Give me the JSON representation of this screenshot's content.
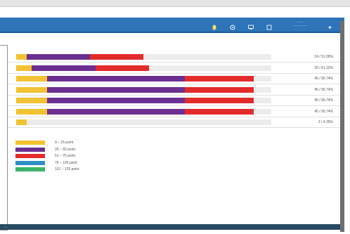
{
  "titlebar": {
    "user_line1": "— —",
    "user_line2": "— — — —"
  },
  "bottom_bar": {
    "label": "—"
  },
  "bars": [
    {
      "yellow": 4,
      "purple": 25,
      "red": 21,
      "value_label": "24 / 51.09%"
    },
    {
      "yellow": 6,
      "purple": 25,
      "red": 21,
      "value_label": "26 / 61.19%"
    },
    {
      "yellow": 12,
      "purple": 54,
      "red": 27,
      "value_label": "45 / 95.74%"
    },
    {
      "yellow": 12,
      "purple": 54,
      "red": 27,
      "value_label": "45 / 95.74%"
    },
    {
      "yellow": 12,
      "purple": 54,
      "red": 27,
      "value_label": "45 / 95.74%"
    },
    {
      "yellow": 12,
      "purple": 54,
      "red": 27,
      "value_label": "45 / 95.74%"
    },
    {
      "yellow": 4,
      "purple": 0,
      "red": 0,
      "value_label": "2 / 4.26%"
    }
  ],
  "bar_scale_max": 100,
  "legend": [
    {
      "label": "0 – 25 point",
      "color": "#f3c233"
    },
    {
      "label": "26 – 50 point",
      "color": "#6b2f91"
    },
    {
      "label": "51 – 75 point",
      "color": "#e32b2b"
    },
    {
      "label": "76 – 100 point",
      "color": "#2d8fc4"
    },
    {
      "label": "101 – 125 point",
      "color": "#3bb36a"
    }
  ],
  "colors": {
    "yellow": "#f3c233",
    "purple": "#6b2f91",
    "red": "#e32b2b",
    "titlebar": "#2d74b8"
  },
  "icons": [
    "bell-icon",
    "gear-icon",
    "monitor-icon",
    "window-icon",
    "settings-icon",
    "logout-icon"
  ]
}
